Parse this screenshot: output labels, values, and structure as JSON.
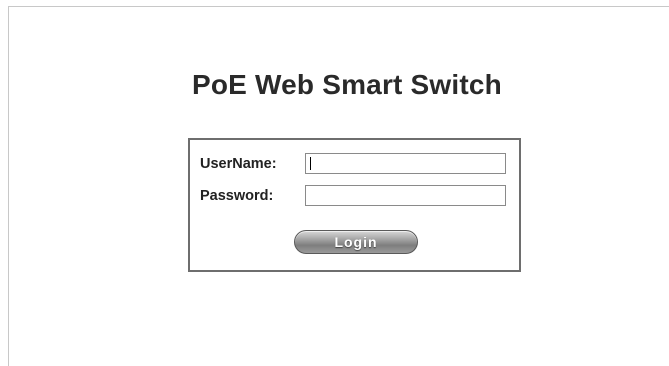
{
  "page": {
    "title": "PoE Web Smart Switch"
  },
  "login_form": {
    "username_label": "UserName:",
    "username_value": "",
    "password_label": "Password:",
    "password_value": "",
    "login_button_label": "Login"
  },
  "colors": {
    "background": "#ffffff",
    "title_text": "#2a2a2a",
    "box_border": "#6e6e6e",
    "button_gray": "#8e8e8e"
  }
}
